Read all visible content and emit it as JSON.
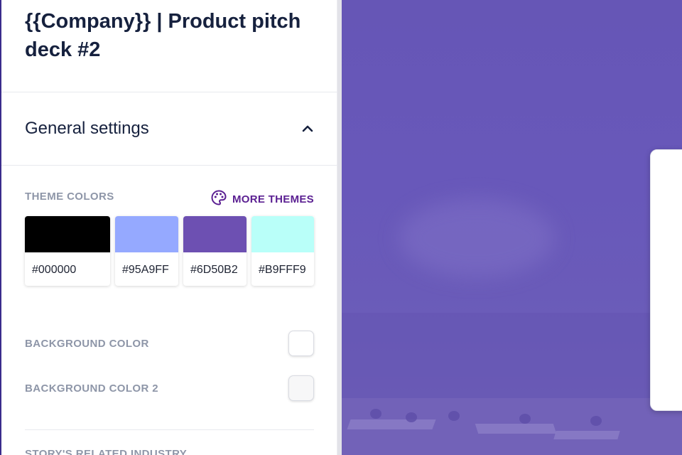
{
  "deck": {
    "title": "{{Company}} | Product pitch deck #2"
  },
  "general_settings": {
    "title": "General settings",
    "theme_colors_label": "THEME COLORS",
    "more_themes_label": "MORE THEMES",
    "swatches": [
      {
        "hex": "#000000",
        "color": "#000000"
      },
      {
        "hex": "#95A9FF",
        "color": "#95A9FF"
      },
      {
        "hex": "#6D50B2",
        "color": "#6D50B2"
      },
      {
        "hex": "#B9FFF9",
        "color": "#B9FFF9"
      }
    ],
    "background_color_label": "BACKGROUND COLOR",
    "background_color_2_label": "BACKGROUND COLOR 2",
    "background_color_value": "#FFFFFF",
    "background_color_2_value": "#F7F7F8",
    "industry_label": "STORY'S RELATED INDUSTRY"
  },
  "colors": {
    "title": "#16213E",
    "label": "#8E96A8",
    "accent": "#5B2092",
    "canvas_bg": "#6656B6",
    "sidebar_border": "#3B2C8C"
  }
}
